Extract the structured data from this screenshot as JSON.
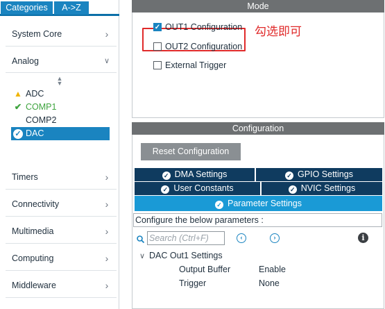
{
  "left_panel": {
    "tabs": [
      "Categories",
      "A->Z"
    ],
    "categories": {
      "system_core": "System Core",
      "analog": "Analog",
      "timers": "Timers",
      "connectivity": "Connectivity",
      "multimedia": "Multimedia",
      "computing": "Computing",
      "middleware": "Middleware"
    },
    "analog_items": [
      {
        "label": "ADC",
        "icon": "warning-icon",
        "color": "#f0b400"
      },
      {
        "label": "COMP1",
        "icon": "check-icon",
        "color": "#3ea43e"
      },
      {
        "label": "COMP2",
        "icon": "",
        "color": "#1f2f3d"
      },
      {
        "label": "DAC",
        "icon": "check-circle-icon",
        "selected": true
      }
    ],
    "accent_color": "#1a84c0"
  },
  "mode": {
    "header": "Mode",
    "options": [
      {
        "label": "OUT1 Configuration",
        "checked": true
      },
      {
        "label": "OUT2 Configuration",
        "checked": false
      },
      {
        "label": "External Trigger",
        "checked": false
      }
    ],
    "annotation": "勾选即可",
    "annotation_color": "#e02a2a"
  },
  "configuration": {
    "header": "Configuration",
    "reset_button": "Reset Configuration",
    "tabs": {
      "dma": "DMA Settings",
      "gpio": "GPIO Settings",
      "user_constants": "User Constants",
      "nvic": "NVIC Settings",
      "parameter": "Parameter Settings"
    },
    "prompt": "Configure the below parameters :",
    "search_placeholder": "Search (Ctrl+F)",
    "group": "DAC Out1 Settings",
    "params": [
      {
        "name": "Output Buffer",
        "value": "Enable"
      },
      {
        "name": "Trigger",
        "value": "None"
      }
    ]
  }
}
